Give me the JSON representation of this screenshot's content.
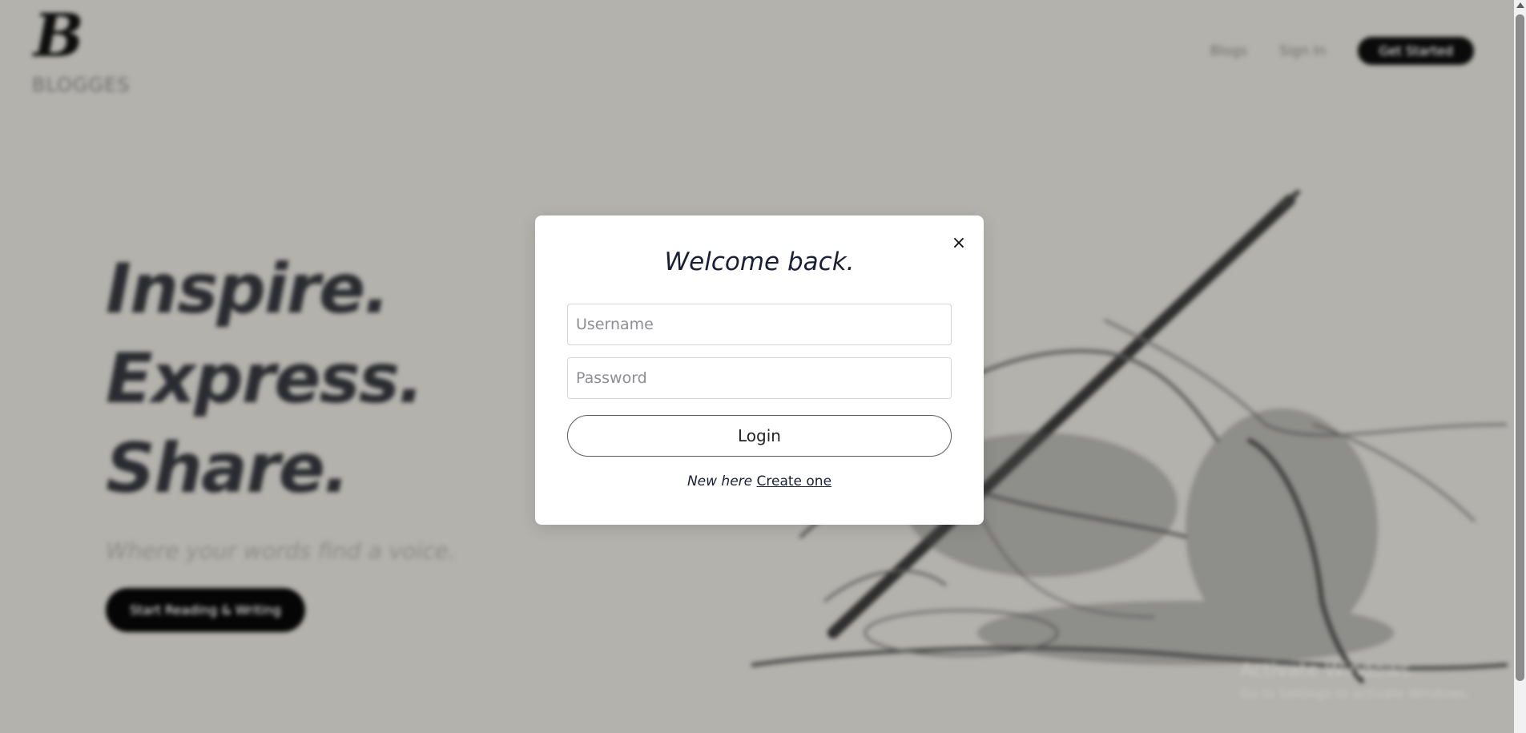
{
  "header": {
    "logo_mark": "B",
    "logo_word": "BLOGGES",
    "nav": {
      "blogs": "Blogs",
      "sign_in": "Sign In",
      "get_started": "Get Started"
    }
  },
  "hero": {
    "lines": [
      "Inspire.",
      "Express.",
      "Share."
    ],
    "subtitle": "Where your words find a voice.",
    "cta": "Start Reading & Writing"
  },
  "modal": {
    "title": "Welcome back.",
    "close_glyph": "×",
    "username_placeholder": "Username",
    "password_placeholder": "Password",
    "login_label": "Login",
    "footer_prompt": "New here",
    "footer_link": "Create one"
  },
  "watermark": {
    "line1": "Activate Windows",
    "line2": "Go to Settings to activate Windows."
  },
  "colors": {
    "overlay_bg": "#b3b2ad",
    "modal_bg": "#ffffff",
    "heading": "#1a1f36",
    "button_dark": "#0a0a0a"
  },
  "icons": {
    "close": "close-icon",
    "scroll_up": "chevron-up-icon"
  }
}
